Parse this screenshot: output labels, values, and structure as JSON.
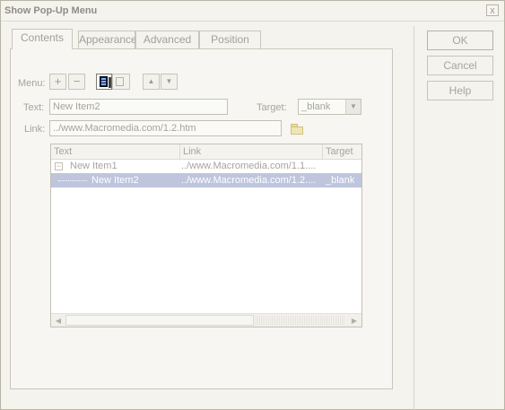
{
  "window": {
    "title": "Show Pop-Up Menu",
    "close_glyph": "x"
  },
  "tabs": [
    {
      "label": "Contents",
      "active": true
    },
    {
      "label": "Appearance",
      "active": false
    },
    {
      "label": "Advanced",
      "active": false
    },
    {
      "label": "Position",
      "active": false
    }
  ],
  "menu_toolbar": {
    "label": "Menu:",
    "add_glyph": "+",
    "remove_glyph": "−",
    "up_glyph": "▲",
    "down_glyph": "▼"
  },
  "form": {
    "text_label": "Text:",
    "text_value": "New Item2",
    "target_label": "Target:",
    "target_value": "_blank",
    "link_label": "Link:",
    "link_value": "../www.Macromedia.com/1.2.htm"
  },
  "tree": {
    "columns": [
      "Text",
      "Link",
      "Target"
    ],
    "rows": [
      {
        "text": "New Item1",
        "link": "../www.Macromedia.com/1.1....",
        "target": "",
        "expander": "−",
        "selected": false
      },
      {
        "text": "New Item2",
        "link": "../www.Macromedia.com/1.2....",
        "target": "_blank",
        "selected": true
      }
    ],
    "scroll_left_glyph": "◀",
    "scroll_right_glyph": "▶"
  },
  "buttons": {
    "ok": "OK",
    "cancel": "Cancel",
    "help": "Help"
  },
  "icons": {
    "add": "plus-icon",
    "remove": "minus-icon",
    "outdent": "outdent-icon",
    "indent": "indent-icon",
    "move_up": "arrow-up-icon",
    "move_down": "arrow-down-icon",
    "browse": "folder-icon",
    "dropdown": "chevron-down-icon"
  },
  "colors": {
    "window_bg": "#f4f3ee",
    "disabled_text": "#a6a49d",
    "selection_bg": "#bec5dd",
    "selection_text": "#ffffff"
  }
}
